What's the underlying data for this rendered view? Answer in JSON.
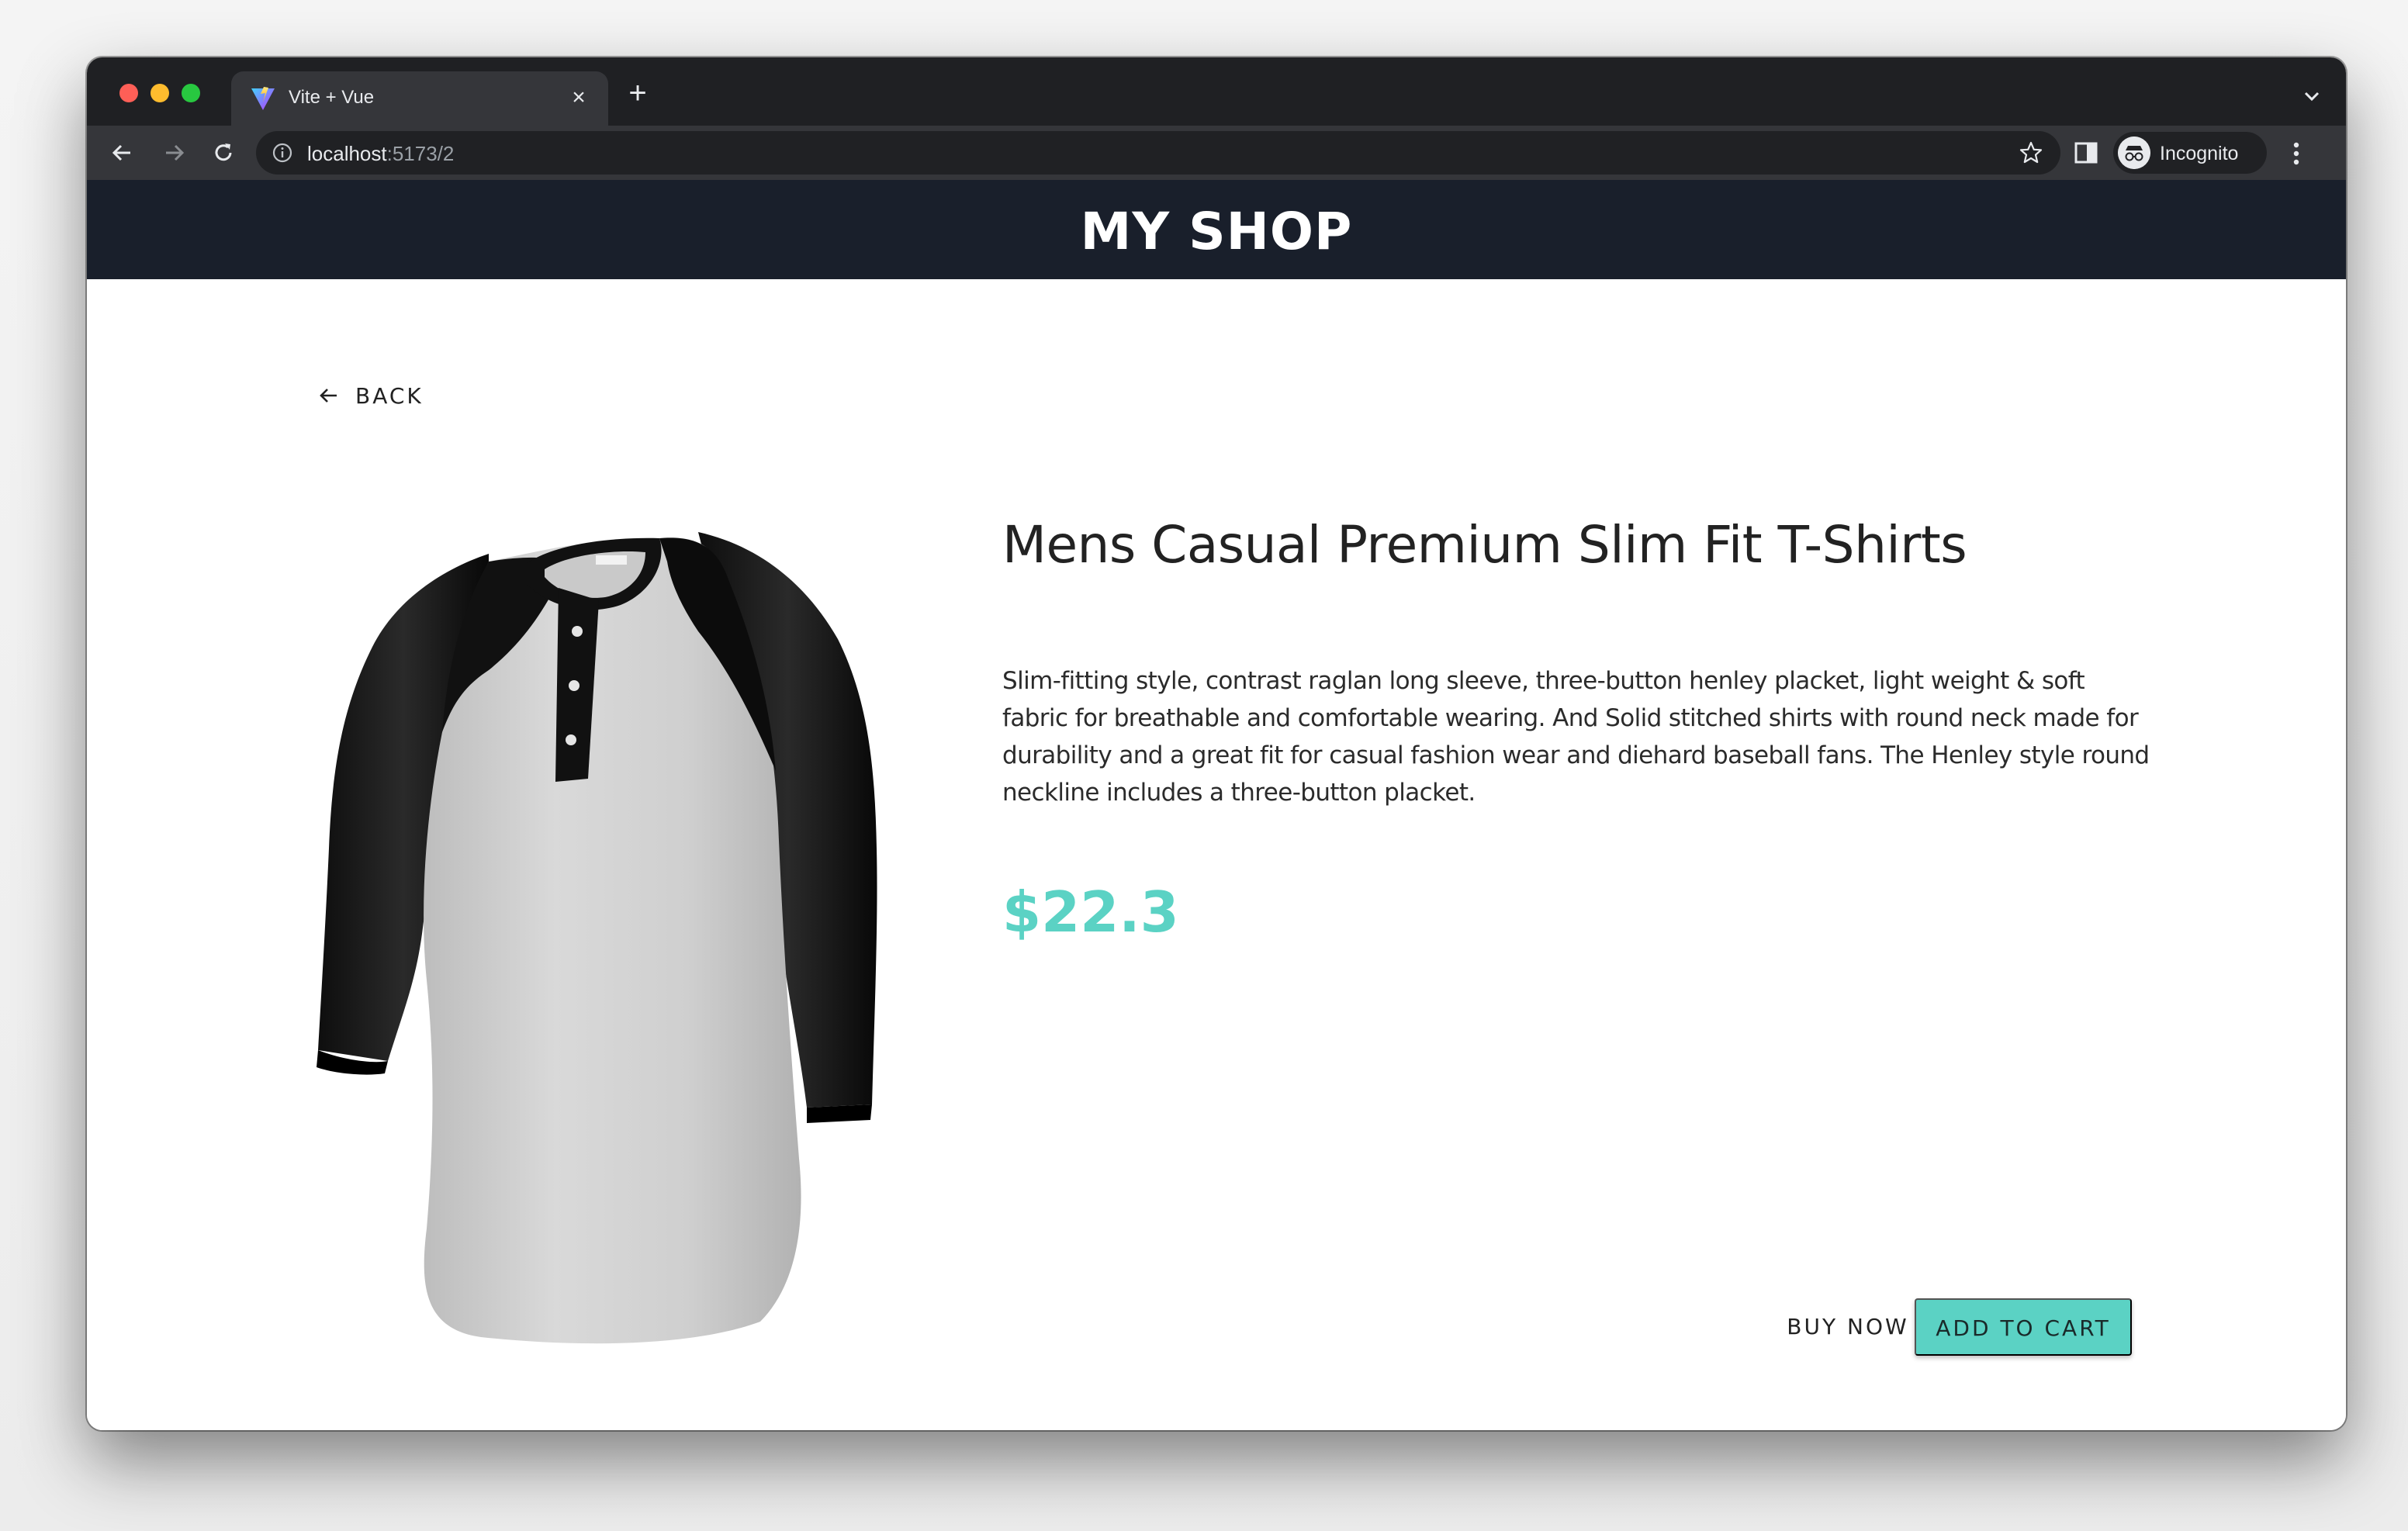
{
  "browser": {
    "tab": {
      "title": "Vite + Vue",
      "close_glyph": "×"
    },
    "new_tab_glyph": "+",
    "url": {
      "host": "localhost",
      "path": ":5173/2"
    },
    "profile_label": "Incognito"
  },
  "app": {
    "title": "MY SHOP",
    "back_label": "BACK",
    "product": {
      "title": "Mens Casual Premium Slim Fit T-Shirts",
      "description": "Slim-fitting style, contrast raglan long sleeve, three-button henley placket, light weight & soft fabric for breathable and comfortable wearing. And Solid stitched shirts with round neck made for durability and a great fit for casual fashion wear and diehard baseball fans. The Henley style round neckline includes a three-button placket.",
      "price": "$22.3",
      "image_icon": "henley-raglan-shirt"
    },
    "buttons": {
      "buy_now": "BUY NOW",
      "add_to_cart": "ADD TO CART"
    }
  },
  "colors": {
    "header_bg": "#191f2b",
    "accent": "#5bd2c4",
    "browser_chrome": "#35363a",
    "tabstrip": "#1f2023"
  }
}
